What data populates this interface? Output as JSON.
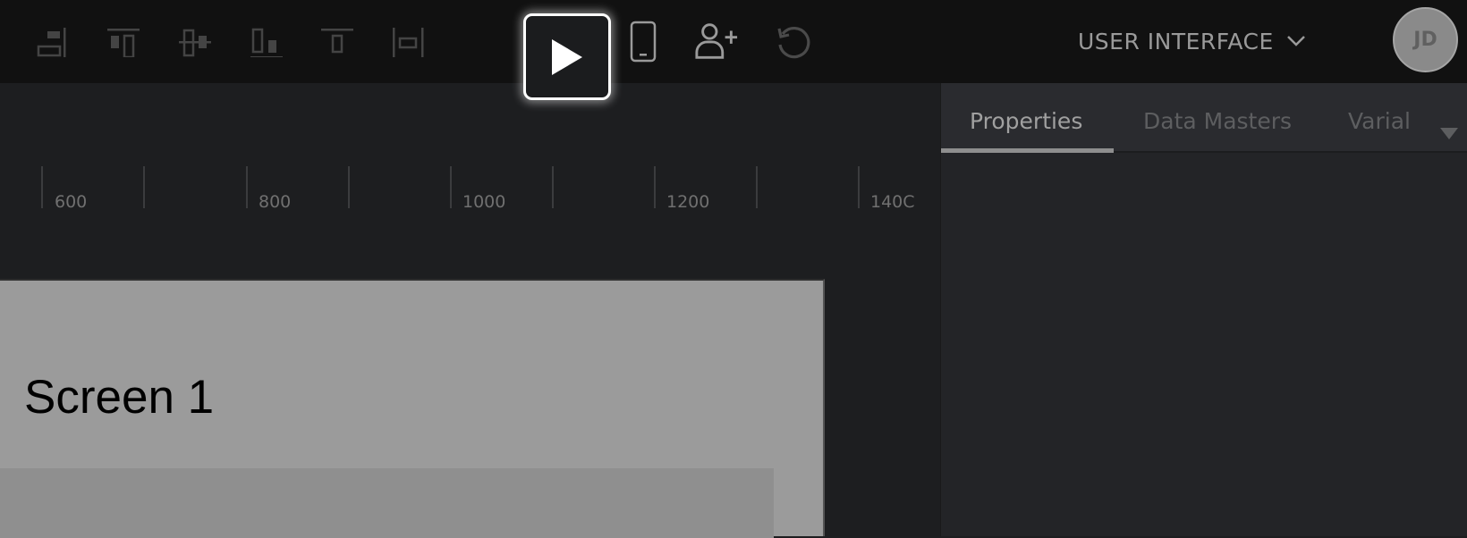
{
  "toolbar": {
    "align_tools": [
      {
        "icon": "align-right-icon",
        "label": "Align right"
      },
      {
        "icon": "align-top-icon",
        "label": "Align top"
      },
      {
        "icon": "align-vertical-center-icon",
        "label": "Align middle"
      },
      {
        "icon": "align-bottom-icon",
        "label": "Align bottom"
      },
      {
        "icon": "distribute-vertical-icon",
        "label": "Distribute vertically"
      },
      {
        "icon": "distribute-horizontal-icon",
        "label": "Distribute horizontally"
      }
    ],
    "play": {
      "icon": "play-icon"
    },
    "device_preview": {
      "icon": "mobile-device-icon"
    },
    "invite_user": {
      "icon": "add-user-icon"
    },
    "undo": {
      "icon": "undo-icon"
    },
    "project_selector": {
      "label": "USER INTERFACE",
      "icon": "chevron-down-icon"
    },
    "avatar": {
      "initials": "JD"
    }
  },
  "ruler": {
    "labels": [
      "600",
      "800",
      "1000",
      "1200",
      "140C"
    ]
  },
  "canvas": {
    "screen_title": "Screen 1"
  },
  "right_panel": {
    "tabs": [
      {
        "label": "Properties",
        "active": true
      },
      {
        "label": "Data Masters",
        "active": false
      },
      {
        "label": "Varial",
        "active": false
      }
    ],
    "more_icon": "caret-down-icon"
  }
}
